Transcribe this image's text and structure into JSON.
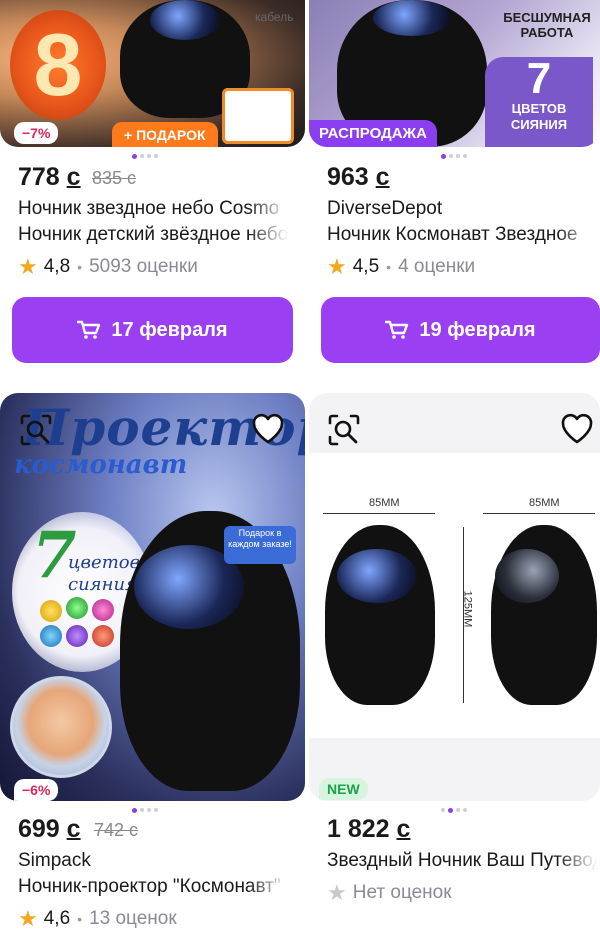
{
  "products": [
    {
      "price": "778",
      "currency": "с",
      "old_price": "835 с",
      "badge_discount": "−7%",
      "badge_extra": "+ ПОДАРОК",
      "image_number": "8",
      "image_note": "кабель",
      "title_line1": "Ночник звездное небо Cosmo",
      "title_line2": "Ночник детский звёздное небо",
      "rating": "4,8",
      "reviews": "5093 оценки",
      "button_label": "17 февраля"
    },
    {
      "price": "963",
      "currency": "с",
      "old_price": "",
      "badge_extra": "РАСПРОДАЖА",
      "image_text1": "БЕСШУМНАЯ РАБОТА",
      "image_number": "7",
      "image_text2": "ЦВЕТОВ СИЯНИЯ",
      "title_line1": "DiverseDepot",
      "title_line2": "Ночник Космонавт Звездное",
      "rating": "4,5",
      "reviews": "4 оценки",
      "button_label": "19 февраля"
    },
    {
      "price": "699",
      "currency": "с",
      "old_price": "742 с",
      "badge_discount": "−6%",
      "image_title": "Проектор",
      "image_subtitle": "космонавт",
      "image_number": "7",
      "image_text2": "цветов сияния",
      "image_gift_note": "Подарок в каждом заказе!",
      "title_line1": "Simpack",
      "title_line2": "Ночник-проектор \"Космонавт\"",
      "rating": "4,6",
      "reviews": "13 оценок"
    },
    {
      "price": "1 822",
      "currency": "с",
      "old_price": "",
      "badge_extra": "NEW",
      "dim_width_left": "85MM",
      "dim_width_right": "85MM",
      "dim_height": "125MM",
      "title_line1": "Звездный Ночник Ваш Путеводитель",
      "reviews": "Нет оценок"
    }
  ],
  "colors": {
    "accent": "#9a3ff2",
    "star": "#f5a623",
    "discount": "#e0245e",
    "new": "#1aa34a"
  }
}
